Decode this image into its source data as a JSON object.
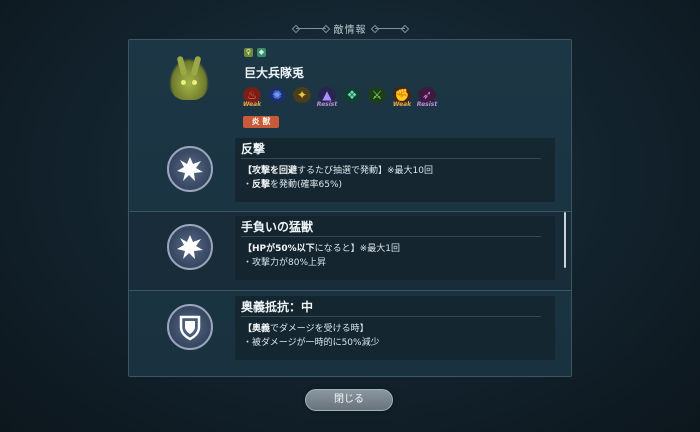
{
  "header": {
    "title": "敵情報"
  },
  "enemy": {
    "name": "巨大兵隊兎",
    "element_badge": "炎 獣",
    "resistances": [
      {
        "icon": "fire-icon",
        "color": "#d9483a",
        "tag": "Weak"
      },
      {
        "icon": "water-icon",
        "color": "#3a6fd9",
        "tag": ""
      },
      {
        "icon": "wind-icon",
        "color": "#c7b53a",
        "tag": ""
      },
      {
        "icon": "thunder-icon",
        "color": "#6a5ae0",
        "tag": "Resist"
      },
      {
        "icon": "light-icon",
        "color": "#3ab88a",
        "tag": ""
      },
      {
        "icon": "sword-icon",
        "color": "#5ab84a",
        "tag": ""
      },
      {
        "icon": "fist-icon",
        "color": "#e07a30",
        "tag": "Weak"
      },
      {
        "icon": "arrow-icon",
        "color": "#c85ac8",
        "tag": "Resist"
      }
    ]
  },
  "skills": [
    {
      "name": "反撃",
      "icon": "burst-icon",
      "line1_hl": "【攻撃を回避",
      "line1_rest": "するたび抽選で発動】※最大10回",
      "line2_prefix": "・",
      "line2_hl": "反撃",
      "line2_rest": "を発動(確率65%)"
    },
    {
      "name": "手負いの猛獣",
      "icon": "burst-icon",
      "line1_hl": "【HPが50%以下",
      "line1_rest": "になると】※最大1回",
      "line2_prefix": "・",
      "line2_hl": "",
      "line2_rest": "攻撃力が80%上昇"
    },
    {
      "name": "奥義抵抗：中",
      "icon": "shield-icon",
      "line1_hl": "【奥義",
      "line1_rest": "でダメージを受ける時】",
      "line2_prefix": "・",
      "line2_hl": "",
      "line2_rest": "被ダメージが一時的に50%減少"
    }
  ],
  "close_label": "閉じる"
}
